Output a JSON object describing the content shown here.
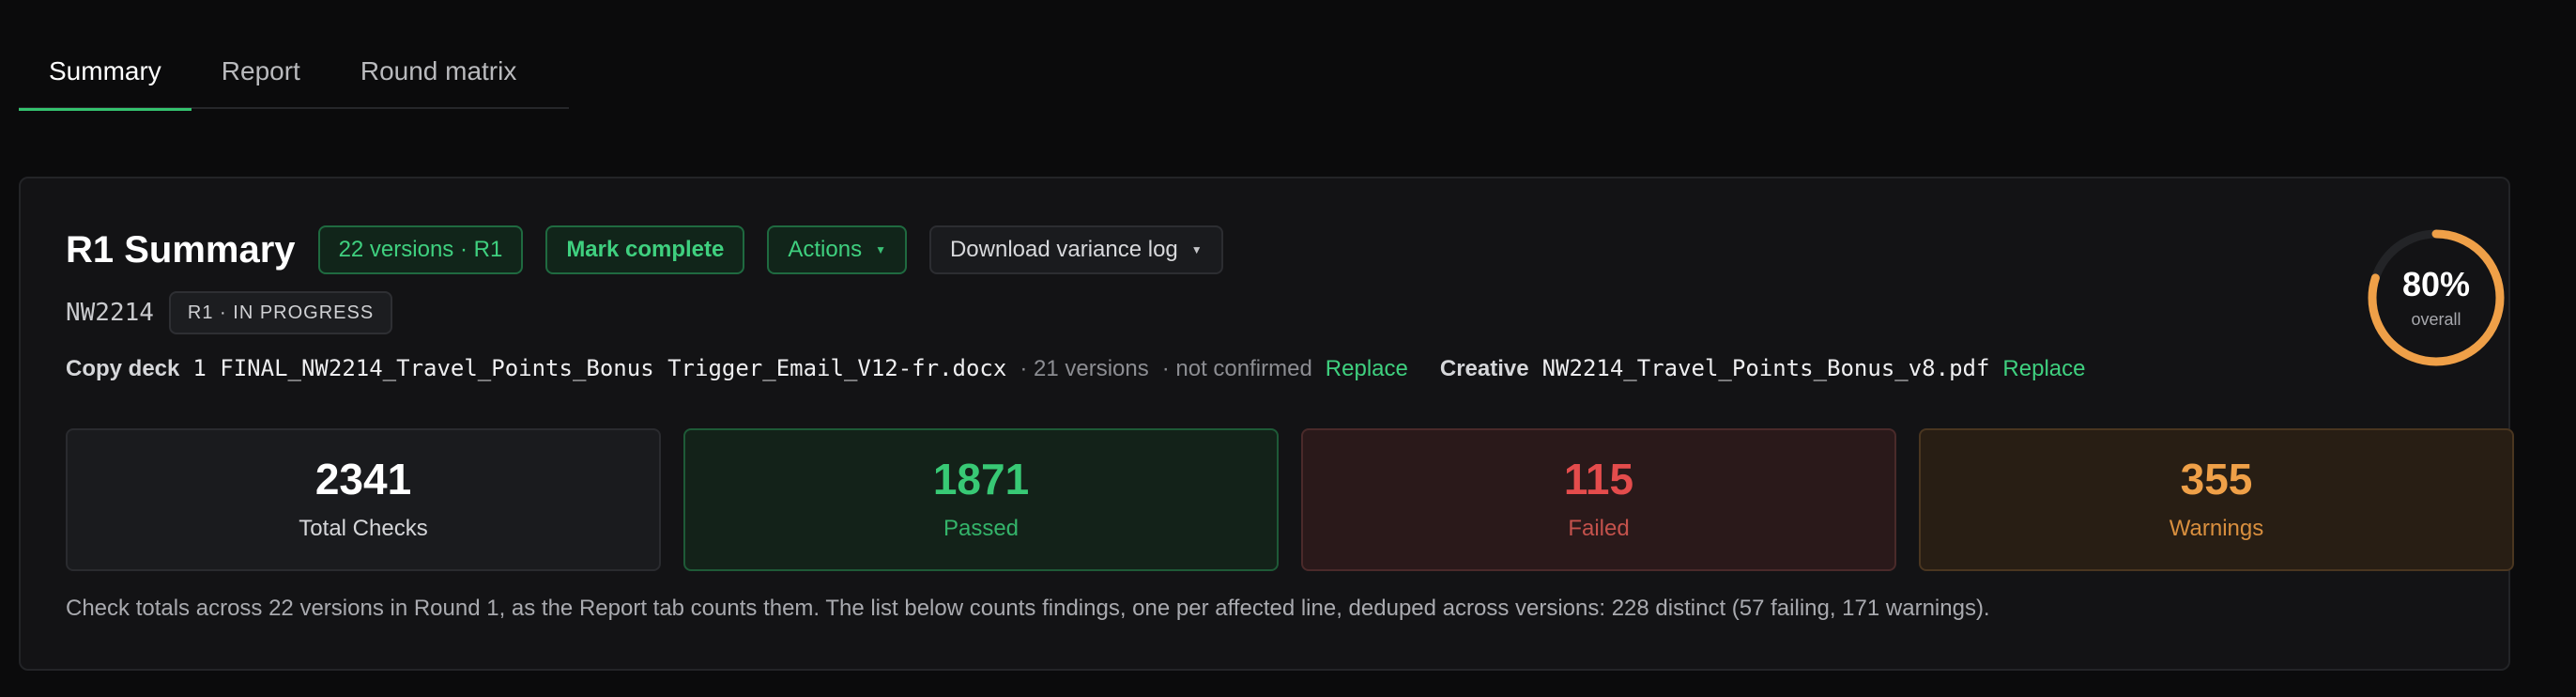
{
  "tabs": [
    {
      "label": "Summary",
      "active": true
    },
    {
      "label": "Report",
      "active": false
    },
    {
      "label": "Round matrix",
      "active": false
    }
  ],
  "panel": {
    "title": "R1 Summary",
    "versions_pill": "22 versions · R1",
    "mark_complete": "Mark complete",
    "actions": "Actions",
    "download": "Download variance log",
    "job_code": "NW2214",
    "status": "R1 · IN PROGRESS",
    "copy_deck": {
      "label": "Copy deck",
      "file": "1 FINAL_NW2214_Travel_Points_Bonus Trigger_Email_V12-fr.docx",
      "versions": "· 21 versions",
      "confirmation": "· not confirmed",
      "replace": "Replace"
    },
    "creative": {
      "label": "Creative",
      "file": "NW2214_Travel_Points_Bonus_v8.pdf",
      "replace": "Replace"
    },
    "progress": {
      "value": 0.8,
      "percent_label": "80%",
      "caption": "overall"
    },
    "stats": {
      "total": {
        "value": "2341",
        "label": "Total Checks"
      },
      "passed": {
        "value": "1871",
        "label": "Passed"
      },
      "failed": {
        "value": "115",
        "label": "Failed"
      },
      "warnings": {
        "value": "355",
        "label": "Warnings"
      }
    },
    "footnote": "Check totals across 22 versions in Round 1, as the Report tab counts them. The list below counts findings, one per affected line, deduped across versions: 228 distinct (57 failing, 171 warnings)."
  },
  "colors": {
    "accent_green": "#3fd07f",
    "failed_red": "#e44c4c",
    "warning_orange": "#efa048",
    "ring_track": "#232427"
  }
}
